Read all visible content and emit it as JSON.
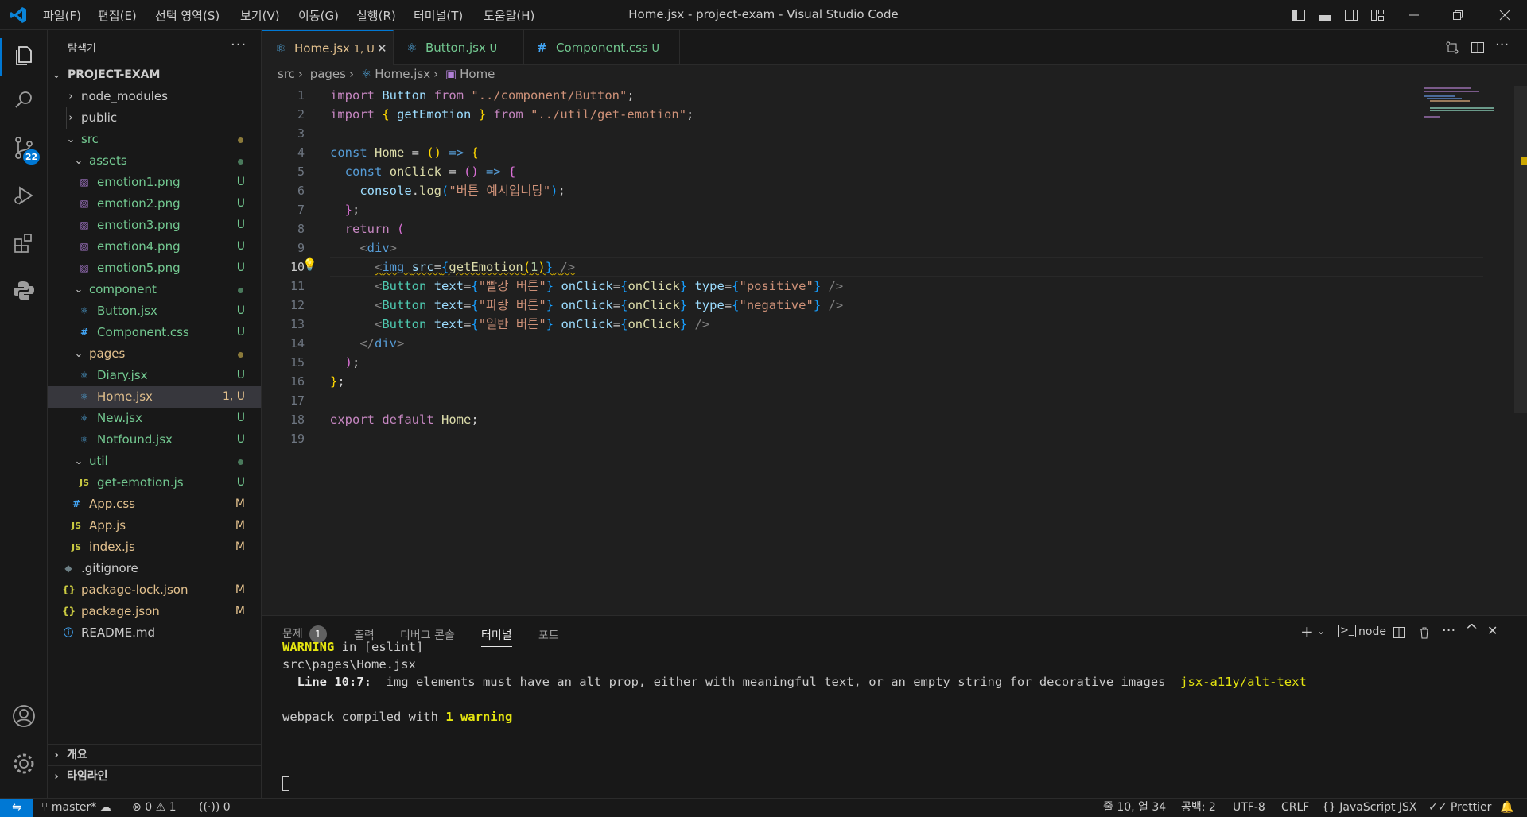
{
  "window": {
    "title": "Home.jsx - project-exam - Visual Studio Code",
    "menu": [
      "파일(F)",
      "편집(E)",
      "선택 영역(S)",
      "보기(V)",
      "이동(G)",
      "실행(R)",
      "터미널(T)",
      "도움말(H)"
    ]
  },
  "activity": {
    "scm_badge": "22"
  },
  "sidebar": {
    "title": "탐색기",
    "more": "···",
    "project": "PROJECT-EXAM",
    "items": [
      {
        "label": "node_modules",
        "status": ""
      },
      {
        "label": "public",
        "status": ""
      },
      {
        "label": "src",
        "status": ""
      },
      {
        "label": "assets",
        "status": ""
      },
      {
        "label": "emotion1.png",
        "status": "U"
      },
      {
        "label": "emotion2.png",
        "status": "U"
      },
      {
        "label": "emotion3.png",
        "status": "U"
      },
      {
        "label": "emotion4.png",
        "status": "U"
      },
      {
        "label": "emotion5.png",
        "status": "U"
      },
      {
        "label": "component",
        "status": ""
      },
      {
        "label": "Button.jsx",
        "status": "U"
      },
      {
        "label": "Component.css",
        "status": "U"
      },
      {
        "label": "pages",
        "status": ""
      },
      {
        "label": "Diary.jsx",
        "status": "U"
      },
      {
        "label": "Home.jsx",
        "status": "1, U"
      },
      {
        "label": "New.jsx",
        "status": "U"
      },
      {
        "label": "Notfound.jsx",
        "status": "U"
      },
      {
        "label": "util",
        "status": ""
      },
      {
        "label": "get-emotion.js",
        "status": "U"
      },
      {
        "label": "App.css",
        "status": "M"
      },
      {
        "label": "App.js",
        "status": "M"
      },
      {
        "label": "index.js",
        "status": "M"
      },
      {
        "label": ".gitignore",
        "status": ""
      },
      {
        "label": "package-lock.json",
        "status": "M"
      },
      {
        "label": "package.json",
        "status": "M"
      },
      {
        "label": "README.md",
        "status": ""
      }
    ],
    "outline": "개요",
    "timeline": "타임라인"
  },
  "tabs": [
    {
      "label": "Home.jsx",
      "status": "1, U"
    },
    {
      "label": "Button.jsx",
      "status": "U"
    },
    {
      "label": "Component.css",
      "status": "U"
    }
  ],
  "breadcrumb": [
    "src",
    "pages",
    "Home.jsx",
    "Home"
  ],
  "code": {
    "line_numbers": [
      "1",
      "2",
      "3",
      "4",
      "5",
      "6",
      "7",
      "8",
      "9",
      "10",
      "11",
      "12",
      "13",
      "14",
      "15",
      "16",
      "17",
      "18",
      "19"
    ],
    "l1": {
      "kw": "import",
      "name": "Button",
      "from": "from",
      "path": "\"../component/Button\"",
      "end": ";"
    },
    "l2": {
      "kw": "import",
      "open": "{",
      "name": "getEmotion",
      "close": "}",
      "from": "from",
      "path": "\"../util/get-emotion\"",
      "end": ";"
    },
    "l4": {
      "kw": "const",
      "name": "Home",
      "rest1": " = ",
      "paren": "()",
      "arrow": "=>",
      "brace": "{"
    },
    "l5": {
      "kw": "const",
      "name": "onClick",
      "rest1": " = ",
      "paren": "()",
      "arrow": "=>",
      "brace": "{"
    },
    "l6": {
      "obj": "console",
      "dot": ".",
      "fn": "log",
      "open": "(",
      "str": "\"버튼 예시입니당\"",
      "close": ")",
      "end": ";"
    },
    "l7": {
      "brace": "}",
      "end": ";"
    },
    "l8": {
      "kw": "return",
      "paren": "("
    },
    "l9": {
      "open": "<",
      "tag": "div",
      "close": ">"
    },
    "l10": {
      "open": "<",
      "tag": "img",
      "attr": "src",
      "eq": "=",
      "lb": "{",
      "fn": "getEmotion",
      "lp": "(",
      "num": "1",
      "rp": ")",
      "rb": "}",
      "close": "/>"
    },
    "l11": {
      "open": "<",
      "tag": "Button",
      "a1": "text",
      "eq": "=",
      "lb1": "{",
      "s1": "\"빨강 버튼\"",
      "rb1": "}",
      "a2": "onClick",
      "lb2": "{",
      "v2": "onClick",
      "rb2": "}",
      "a3": "type",
      "lb3": "{",
      "s3": "\"positive\"",
      "rb3": "}",
      "close": "/>"
    },
    "l12": {
      "open": "<",
      "tag": "Button",
      "a1": "text",
      "eq": "=",
      "lb1": "{",
      "s1": "\"파랑 버튼\"",
      "rb1": "}",
      "a2": "onClick",
      "lb2": "{",
      "v2": "onClick",
      "rb2": "}",
      "a3": "type",
      "lb3": "{",
      "s3": "\"negative\"",
      "rb3": "}",
      "close": "/>"
    },
    "l13": {
      "open": "<",
      "tag": "Button",
      "a1": "text",
      "eq": "=",
      "lb1": "{",
      "s1": "\"일반 버튼\"",
      "rb1": "}",
      "a2": "onClick",
      "lb2": "{",
      "v2": "onClick",
      "rb2": "}",
      "close": "/>"
    },
    "l14": {
      "open": "</",
      "tag": "div",
      "close": ">"
    },
    "l15": {
      "paren": ")",
      "end": ";"
    },
    "l16": {
      "brace": "}",
      "end": ";"
    },
    "l18": {
      "kw1": "export",
      "kw2": "default",
      "name": "Home",
      "end": ";"
    }
  },
  "panel": {
    "tabs": [
      "문제",
      "출력",
      "디버그 콘솔",
      "터미널",
      "포트"
    ],
    "problems_count": "1",
    "terminal_name": "node",
    "lines": {
      "w1_bold": "WARNING",
      "w1_rest": " in [eslint]",
      "w2": "src\\pages\\Home.jsx",
      "w3_bold": "  Line 10:7:",
      "w3_rest": "  img elements must have an alt prop, either with meaningful text, or an empty string for decorative images  ",
      "w3_link": "jsx-a11y/alt-text",
      "w4_pre": "webpack compiled with ",
      "w4_bold": "1 warning"
    }
  },
  "status": {
    "branch": "master*",
    "errors": "0",
    "warnings": "1",
    "ports": "0",
    "position": "줄 10, 열 34",
    "spaces": "공백: 2",
    "encoding": "UTF-8",
    "eol": "CRLF",
    "language": "JavaScript JSX",
    "formatter": "Prettier"
  },
  "colors": {
    "accent": "#0078d4",
    "untracked": "#73c991",
    "modified": "#e2c08d"
  }
}
